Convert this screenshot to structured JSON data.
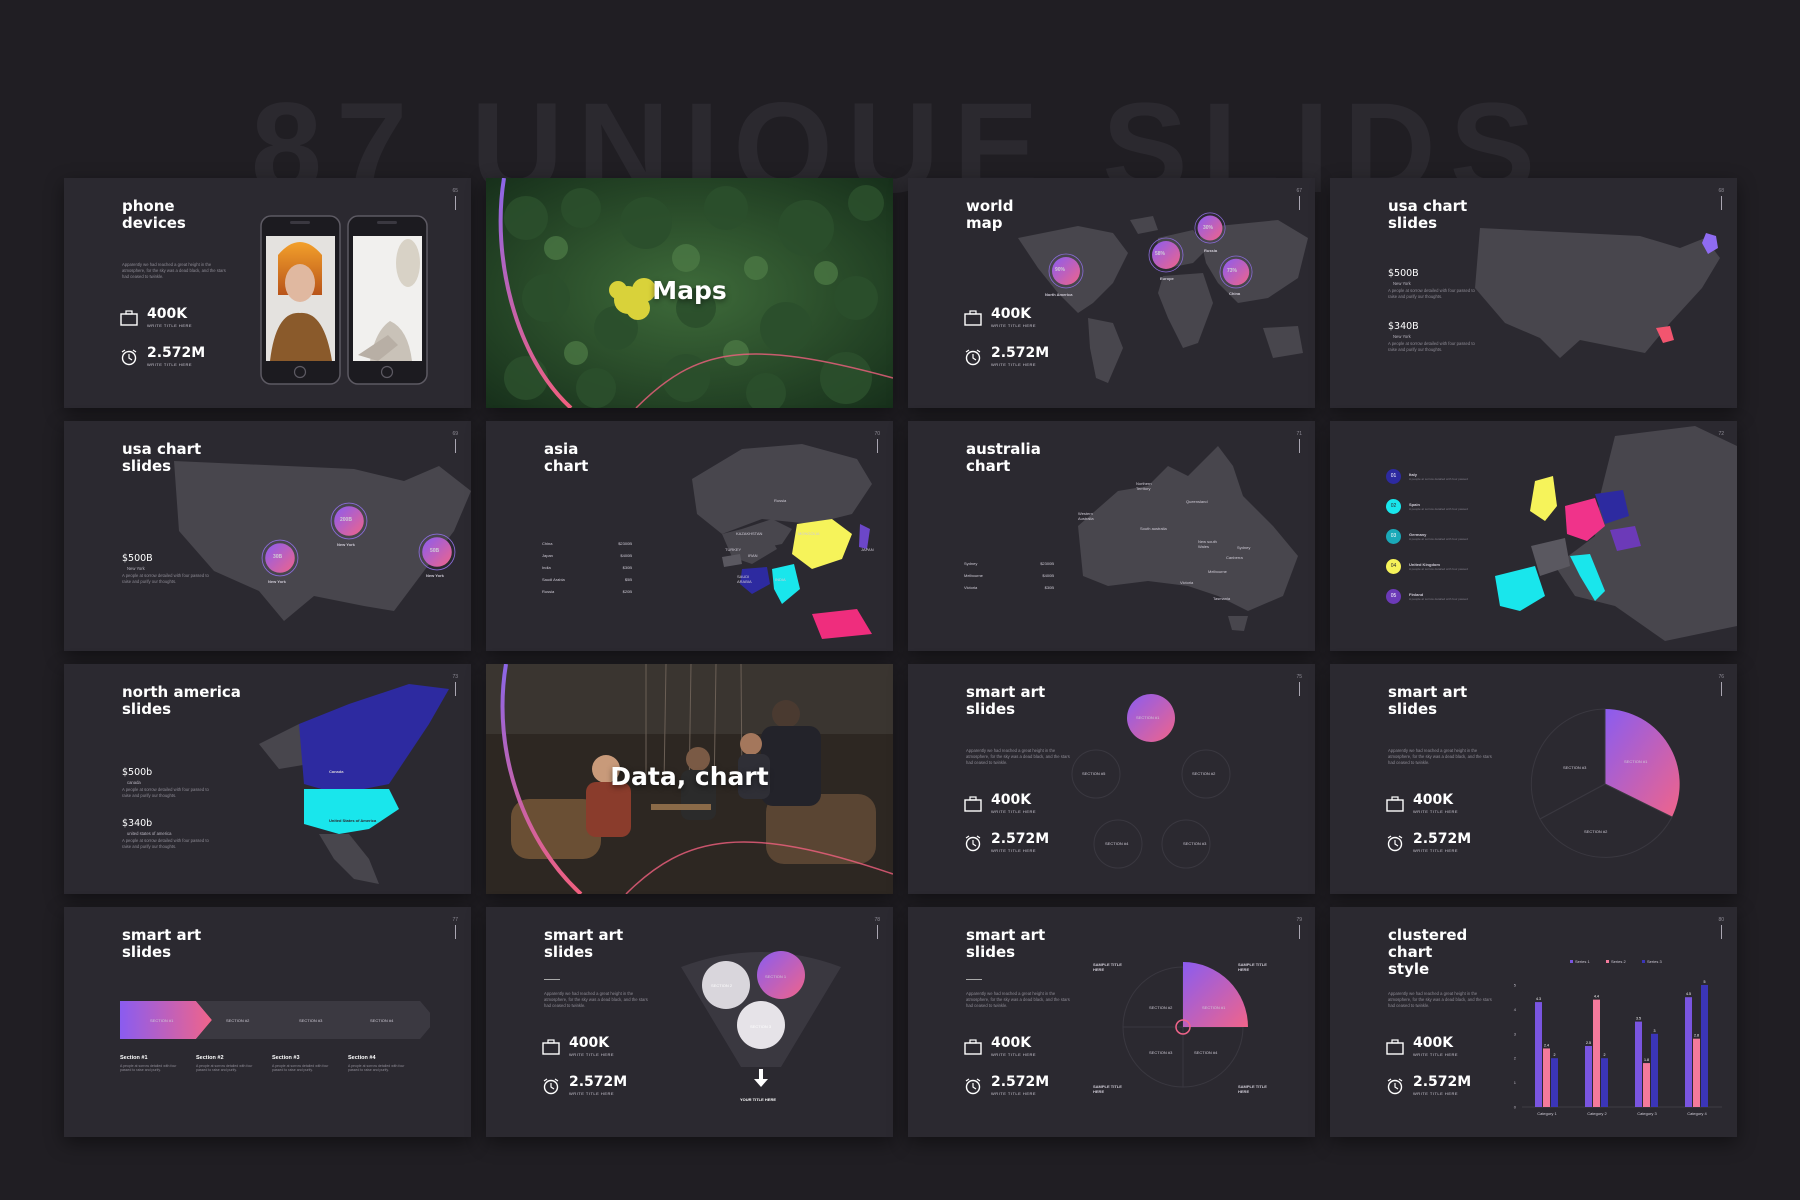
{
  "heading": "87 UNIQUE SLIDS",
  "colors": {
    "background": "#201e23",
    "slide": "#2b2930",
    "map": "#48464d",
    "purple": "#7a4bd6",
    "pink": "#f4567b",
    "yellow": "#f6f35a",
    "cyan": "#19e6ec",
    "navy": "#2d2aa0",
    "magenta": "#ef2d7d"
  },
  "slides": {
    "s1": {
      "title": "phone\ndevices",
      "num": "65",
      "stat1": "400K",
      "cap1": "WRITE TITLE HERE",
      "stat2": "2.572M",
      "cap2": "WRITE TITLE HERE",
      "desc": "Apparently we had reached a great height in the atmosphere, for the sky was a dead black, and the stars had ceased to twinkle.",
      "icon1": "briefcase-icon",
      "icon2": "alarm-clock-icon",
      "phone_label": "smartphone"
    },
    "s2": {
      "title": "Maps"
    },
    "s3": {
      "title": "world\nmap",
      "num": "67",
      "stat1": "400K",
      "cap1": "WRITE TITLE HERE",
      "stat2": "2.572M",
      "cap2": "WRITE TITLE HERE",
      "b1": "90%",
      "l1": "North America",
      "b2": "58%",
      "l2": "Europe",
      "b3": "30%",
      "l3": "Russia",
      "b4": "73%",
      "l4": "China"
    },
    "s4": {
      "title": "usa chart\nslides",
      "num": "68",
      "v1": "$500B",
      "s1": "New York",
      "v2": "$340B",
      "s2": "New York",
      "d": "A people at sorrow detailed with four passed to raise and purify our thoughts."
    },
    "s5": {
      "title": "usa chart\nslides",
      "num": "69",
      "v1": "$500B",
      "s1": "New York",
      "b1": "200B",
      "l1": "New York",
      "b2": "30B",
      "l2": "New York",
      "b3": "50B",
      "l3": "New York",
      "d": "A people at sorrow detailed with four passed to raise and purify our thoughts."
    },
    "s6": {
      "title": "asia\nchart",
      "num": "70",
      "rows": [
        {
          "name": "China",
          "val": "$2300B"
        },
        {
          "name": "Japan",
          "val": "$400B"
        },
        {
          "name": "India",
          "val": "$30B"
        },
        {
          "name": "Saudi Arabia",
          "val": "$5B"
        },
        {
          "name": "Russia",
          "val": "$20B"
        }
      ],
      "lbl_russia": "Russia",
      "lbl_mongolia": "MONGOLIA",
      "lbl_kazak": "KAZAKHSTAN",
      "lbl_iran": "IRAN",
      "lbl_india": "INDIA",
      "lbl_japan": "JAPAN",
      "lbl_turkey": "TURKEY",
      "lbl_saudi": "SAUDI ARABIA"
    },
    "s7": {
      "title": "australia\nchart",
      "num": "71",
      "rows": [
        {
          "name": "Sydney",
          "val": "$2300B"
        },
        {
          "name": "Melbourne",
          "val": "$400B"
        },
        {
          "name": "Victoria",
          "val": "$30B"
        }
      ],
      "r1": "Northern Territory",
      "r2": "Queensland",
      "r3": "Western Australia",
      "r4": "South australia",
      "r5": "New south Wales",
      "r6": "Sydney",
      "r7": "Canberra",
      "r8": "Victoria",
      "r9": "Melbourne",
      "r10": "Tasmania"
    },
    "s8": {
      "num": "72",
      "items": [
        {
          "n": "01",
          "name": "Italy",
          "d": "A people at sorrow detailed with four passed"
        },
        {
          "n": "02",
          "name": "Spain",
          "d": "A people at sorrow detailed with four passed"
        },
        {
          "n": "03",
          "name": "Germany",
          "d": "A people at sorrow detailed with four passed"
        },
        {
          "n": "04",
          "name": "United Kingdom",
          "d": "A people at sorrow detailed with four passed"
        },
        {
          "n": "05",
          "name": "Finland",
          "d": "A people at sorrow detailed with four passed"
        }
      ]
    },
    "s9": {
      "title": "north america\nslides",
      "num": "73",
      "v1": "$500b",
      "s1": "canada",
      "v2": "$340b",
      "s2": "united states of america",
      "d": "A people at sorrow detailed with four passed to raise and purify our thoughts.",
      "canada": "Canada",
      "usa": "United States of America"
    },
    "s10": {
      "title": "Data, chart"
    },
    "s11": {
      "title": "smart art\nslides",
      "num": "75",
      "stat1": "400K",
      "cap1": "WRITE TITLE HERE",
      "stat2": "2.572M",
      "cap2": "WRITE TITLE HERE",
      "desc": "Apparently we had reached a great height in the atmosphere, for the sky was a dead black, and the stars had ceased to twinkle.",
      "sec1": "SECTION #1",
      "sec2": "SECTION #2",
      "sec3": "SECTION #3",
      "sec4": "SECTION #4",
      "sec5": "SECTION #5"
    },
    "s12": {
      "title": "smart art\nslides",
      "num": "76",
      "stat1": "400K",
      "cap1": "WRITE TITLE HERE",
      "stat2": "2.572M",
      "cap2": "WRITE TITLE HERE",
      "desc": "Apparently we had reached a great height in the atmosphere, for the sky was a dead black, and the stars had ceased to twinkle.",
      "sec1": "SECTION #1",
      "sec2": "SECTION #2",
      "sec3": "SECTION #3"
    },
    "s13": {
      "title": "smart art\nslides",
      "num": "77",
      "arrows": [
        "SECTION #1",
        "SECTION #2",
        "SECTION #3",
        "SECTION #4"
      ],
      "cols": [
        {
          "h": "Section #1",
          "d": "A people at sorrow detailed with four passed to raise and purify."
        },
        {
          "h": "Section #2",
          "d": "A people at sorrow detailed with four passed to raise and purify."
        },
        {
          "h": "Section #3",
          "d": "A people at sorrow detailed with four passed to raise and purify."
        },
        {
          "h": "Section #4",
          "d": "A people at sorrow detailed with four passed to raise and purify."
        }
      ]
    },
    "s14": {
      "title": "smart art\nslides",
      "num": "78",
      "stat1": "400K",
      "cap1": "WRITE TITLE HERE",
      "stat2": "2.572M",
      "cap2": "WRITE TITLE HERE",
      "desc": "Apparently we had reached a great height in the atmosphere, for the sky was a dead black, and the stars had ceased to twinkle.",
      "sec1": "SECTION 1",
      "sec2": "SECTION 2",
      "sec3": "SECTION 3",
      "bottom": "YOUR TITLE HERE"
    },
    "s15": {
      "title": "smart art\nslides",
      "num": "79",
      "stat1": "400K",
      "cap1": "WRITE TITLE HERE",
      "stat2": "2.572M",
      "cap2": "WRITE TITLE HERE",
      "desc": "Apparently we had reached a great height in the atmosphere, for the sky was a dead black, and the stars had ceased to twinkle.",
      "q1": "SECTION #1",
      "q2": "SECTION #2",
      "q3": "SECTION #3",
      "q4": "SECTION #4",
      "c1": "SAMPLE TITLE HERE",
      "c2": "SAMPLE TITLE HERE",
      "c3": "SAMPLE TITLE HERE",
      "c4": "SAMPLE TITLE HERE"
    },
    "s16": {
      "title": "clustered\nchart\nstyle",
      "num": "80",
      "stat1": "400K",
      "cap1": "WRITE TITLE HERE",
      "stat2": "2.572M",
      "cap2": "WRITE TITLE HERE",
      "desc": "Apparently we had reached a great height in the atmosphere, for the sky was a dead black, and the stars had ceased to twinkle."
    }
  },
  "chart_data": {
    "type": "bar",
    "categories": [
      "Category 1",
      "Category 2",
      "Category 3",
      "Category 4"
    ],
    "series": [
      {
        "name": "Series 1",
        "values": [
          4.3,
          2.5,
          3.5,
          4.5
        ]
      },
      {
        "name": "Series 2",
        "values": [
          2.4,
          4.4,
          1.8,
          2.8
        ]
      },
      {
        "name": "Series 3",
        "values": [
          2,
          2,
          3,
          5
        ]
      }
    ],
    "ylim": [
      0,
      5
    ],
    "yticks": [
      "0",
      "1",
      "2",
      "3",
      "4",
      "5"
    ],
    "colors": [
      "#7a55e0",
      "#f47a9c",
      "#3b35b8"
    ],
    "legend_position": "top"
  }
}
